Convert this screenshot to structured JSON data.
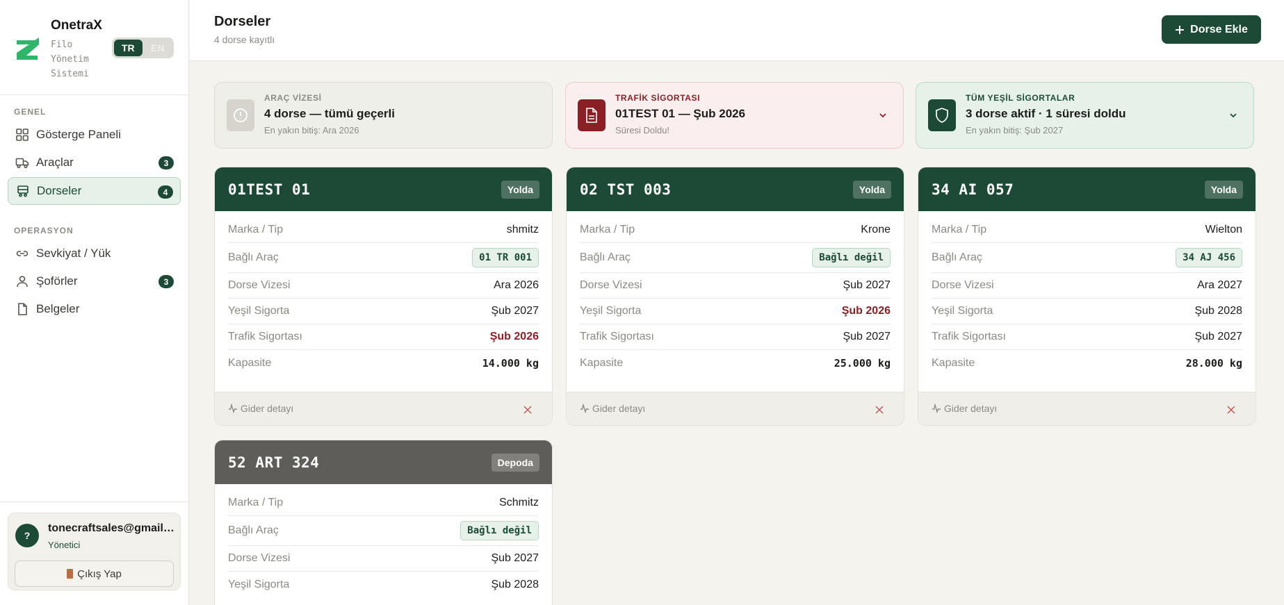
{
  "brand": {
    "name": "OnetraX",
    "subtitle": "Filo Yönetim Sistemi",
    "lang_tr": "TR",
    "lang_en": "EN"
  },
  "nav": {
    "section_general": "GENEL",
    "section_ops": "OPERASYON",
    "items": [
      {
        "label": "Gösterge Paneli",
        "icon": "dashboard-icon"
      },
      {
        "label": "Araçlar",
        "icon": "truck-icon",
        "badge": "3"
      },
      {
        "label": "Dorseler",
        "icon": "trailer-icon",
        "badge": "4"
      },
      {
        "label": "Sevkiyat / Yük",
        "icon": "link-icon"
      },
      {
        "label": "Şoförler",
        "icon": "user-icon",
        "badge": "3"
      },
      {
        "label": "Belgeler",
        "icon": "document-icon"
      }
    ]
  },
  "user": {
    "initial": "?",
    "email": "tonecraftsales@gmail.com",
    "role": "Yönetici",
    "logout": "Çıkış Yap"
  },
  "header": {
    "title": "Dorseler",
    "subtitle": "4 dorse kayıtlı",
    "add_button": "Dorse Ekle"
  },
  "alerts": [
    {
      "label": "ARAÇ VİZESİ",
      "main": "4 dorse — tümü geçerli",
      "sub": "En yakın bitiş: Ara 2026",
      "icon": "alert-circle-icon"
    },
    {
      "label": "TRAFİK SİGORTASI",
      "main": "01TEST 01 — Şub 2026",
      "sub": "Süresi Doldu!",
      "icon": "document-icon"
    },
    {
      "label": "TÜM YEŞİL SİGORTALAR",
      "main": "3 dorse aktif · 1 süresi doldu",
      "sub": "En yakın bitiş: Şub 2027",
      "icon": "shield-icon"
    }
  ],
  "labels": {
    "brand": "Marka / Tip",
    "vehicle": "Bağlı Araç",
    "vize": "Dorse Vizesi",
    "green": "Yeşil Sigorta",
    "traffic": "Trafik Sigortası",
    "capacity": "Kapasite",
    "expense": "Gider detayı"
  },
  "trailers": [
    {
      "plate": "01TEST 01",
      "status": "Yolda",
      "brand": "shmitz",
      "vehicle": "01 TR 001",
      "vize": "Ara 2026",
      "green": "Şub 2027",
      "traffic": "Şub 2026",
      "capacity": "14.000 kg"
    },
    {
      "plate": "02 TST 003",
      "status": "Yolda",
      "brand": "Krone",
      "vehicle": "Bağlı değil",
      "vize": "Şub 2027",
      "green": "Şub 2026",
      "traffic": "Şub 2027",
      "capacity": "25.000 kg"
    },
    {
      "plate": "34 AI 057",
      "status": "Yolda",
      "brand": "Wielton",
      "vehicle": "34 AJ 456",
      "vize": "Ara 2027",
      "green": "Şub 2028",
      "traffic": "Şub 2027",
      "capacity": "28.000 kg"
    },
    {
      "plate": "52 ART 324",
      "status": "Depoda",
      "brand": "Schmitz",
      "vehicle": "Bağlı değil",
      "vize": "Şub 2027",
      "green": "Şub 2028"
    }
  ],
  "colors": {
    "primary": "#1d4a37",
    "danger": "#8a1f25",
    "background": "#f4f3ee",
    "depot": "#5f5d59"
  }
}
